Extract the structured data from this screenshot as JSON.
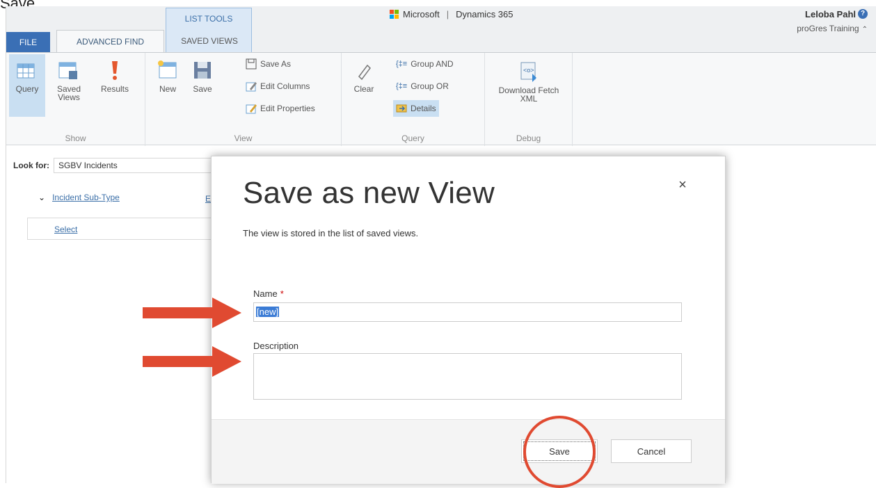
{
  "caption": "Save.",
  "ribbon": {
    "tabs": {
      "file": "FILE",
      "advanced_find": "ADVANCED FIND"
    },
    "list_tools": {
      "title": "LIST TOOLS",
      "tab": "SAVED VIEWS"
    },
    "brand": {
      "company": "Microsoft",
      "product": "Dynamics 365"
    },
    "user": {
      "name": "Leloba Pahl",
      "org": "proGres Training",
      "help": "?"
    },
    "groups": {
      "show": {
        "label": "Show",
        "query": "Query",
        "saved_views_1": "Saved",
        "saved_views_2": "Views",
        "results": "Results"
      },
      "view": {
        "label": "View",
        "new": "New",
        "save": "Save",
        "save_as": "Save As",
        "edit_columns": "Edit Columns",
        "edit_properties": "Edit Properties"
      },
      "query": {
        "label": "Query",
        "clear": "Clear",
        "group_and": "Group AND",
        "group_or": "Group OR",
        "details": "Details"
      },
      "debug": {
        "label": "Debug",
        "download_1": "Download Fetch",
        "download_2": "XML"
      }
    }
  },
  "content": {
    "look_for_label": "Look for:",
    "look_for_value": "SGBV Incidents",
    "condition_field": "Incident Sub-Type",
    "condition_e": "E",
    "select_link": "Select"
  },
  "dialog": {
    "title": "Save as new View",
    "subtitle": "The view is stored in the list of saved views.",
    "name_label": "Name",
    "required_mark": "*",
    "name_value": "[new]",
    "description_label": "Description",
    "save_button": "Save",
    "cancel_button": "Cancel",
    "close": "×"
  },
  "colors": {
    "accent": "#3a6fb5",
    "annotation": "#e04a31"
  }
}
